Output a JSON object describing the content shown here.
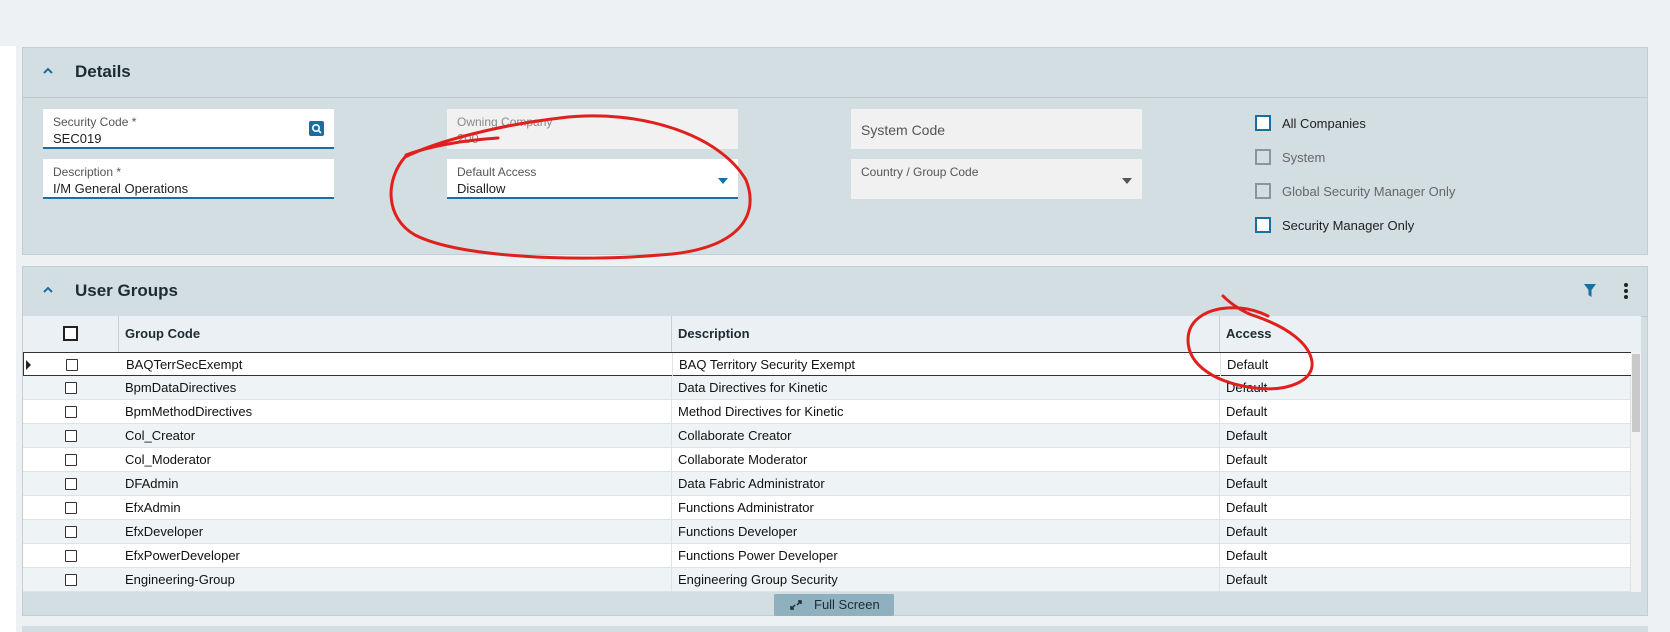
{
  "details": {
    "title": "Details",
    "security_code_label": "Security Code *",
    "security_code_value": "SEC019",
    "owning_company_label": "Owning Company",
    "owning_company_value": "200",
    "system_code_placeholder": "System Code",
    "description_label": "Description *",
    "description_value": "I/M General Operations",
    "default_access_label": "Default Access",
    "default_access_value": "Disallow",
    "country_group_label": "Country / Group Code",
    "checkboxes": [
      {
        "label": "All Companies",
        "checked": false,
        "enabled": true
      },
      {
        "label": "System",
        "checked": false,
        "enabled": false
      },
      {
        "label": "Global Security Manager Only",
        "checked": false,
        "enabled": false
      },
      {
        "label": "Security Manager Only",
        "checked": false,
        "enabled": true
      }
    ]
  },
  "user_groups": {
    "title": "User Groups",
    "columns": [
      "Group Code",
      "Description",
      "Access"
    ],
    "rows": [
      {
        "code": "BAQTerrSecExempt",
        "description": "BAQ Territory Security Exempt",
        "access": "Default"
      },
      {
        "code": "BpmDataDirectives",
        "description": "Data Directives for Kinetic",
        "access": "Default"
      },
      {
        "code": "BpmMethodDirectives",
        "description": "Method Directives for Kinetic",
        "access": "Default"
      },
      {
        "code": "Col_Creator",
        "description": "Collaborate Creator",
        "access": "Default"
      },
      {
        "code": "Col_Moderator",
        "description": "Collaborate Moderator",
        "access": "Default"
      },
      {
        "code": "DFAdmin",
        "description": "Data Fabric Administrator",
        "access": "Default"
      },
      {
        "code": "EfxAdmin",
        "description": "Functions Administrator",
        "access": "Default"
      },
      {
        "code": "EfxDeveloper",
        "description": "Functions Developer",
        "access": "Default"
      },
      {
        "code": "EfxPowerDeveloper",
        "description": "Functions Power Developer",
        "access": "Default"
      },
      {
        "code": "Engineering-Group",
        "description": "Engineering Group Security",
        "access": "Default"
      }
    ],
    "full_screen_label": "Full Screen"
  },
  "colors": {
    "accent": "#1a6fa0",
    "panel_bg": "#d3dee3",
    "annotation_red": "#e0201c"
  }
}
